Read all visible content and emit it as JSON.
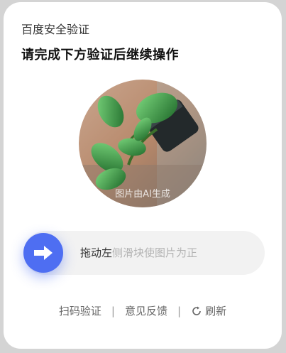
{
  "brand": "百度安全验证",
  "headline": "请完成下方验证后继续操作",
  "captcha": {
    "image_icon": "rotated-plant-image",
    "ai_note": "图片由AI生成"
  },
  "slider": {
    "handle_icon": "arrow-right-icon",
    "hint_dark": "拖动左",
    "hint_light": "侧滑块使图片为正",
    "accent_color": "#4e6ef2"
  },
  "footer": {
    "scan": "扫码验证",
    "separator": "|",
    "feedback": "意见反馈",
    "refresh": "刷新",
    "refresh_icon": "refresh-icon"
  }
}
